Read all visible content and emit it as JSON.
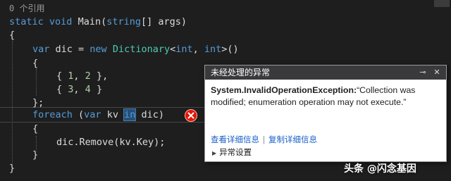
{
  "editor": {
    "references": "0 个引用",
    "line_method": {
      "kw_static": "static",
      "kw_void": "void",
      "rest": " Main(",
      "kw_string": "string",
      "params": "[] args)"
    },
    "open_brace": "{",
    "line_var": {
      "kw_var": "var",
      "mid": " dic = ",
      "kw_new": "new",
      "type_dict": "Dictionary",
      "lt": "<",
      "kw_int1": "int",
      "comma": ", ",
      "kw_int2": "int",
      "gt": ">()"
    },
    "init_open": "{",
    "entry1": {
      "open": "{ ",
      "k": "1",
      "sep": ", ",
      "v": "2",
      "close": " },"
    },
    "entry2": {
      "open": "{ ",
      "k": "3",
      "sep": ", ",
      "v": "4",
      "close": " }"
    },
    "init_close": "};",
    "line_foreach": {
      "kw_foreach": "foreach",
      "paren": " (",
      "kw_var": "var",
      "kv": " kv ",
      "kw_in": "in",
      "rest": " dic)"
    },
    "loop_open": "{",
    "line_remove": "dic.Remove(kv.Key);",
    "loop_close": "}",
    "method_close": "}"
  },
  "exception_popup": {
    "title": "未经处理的异常",
    "pin_glyph": "⊸",
    "close_glyph": "✕",
    "exception_type": "System.InvalidOperationException:",
    "message": "“Collection was modified; enumeration operation may not execute.”",
    "link_details": "查看详细信息",
    "link_copy": "复制详细信息",
    "settings_label": "异常设置"
  },
  "watermark": "头条 @闪念基因",
  "colors": {
    "background": "#1e1e1e",
    "keyword": "#569cd6",
    "type": "#4ec9b0",
    "number": "#b5cea8",
    "popup_title_bar": "#3a3a3c",
    "link": "#1a5fc9",
    "error_icon": "#e51400"
  }
}
